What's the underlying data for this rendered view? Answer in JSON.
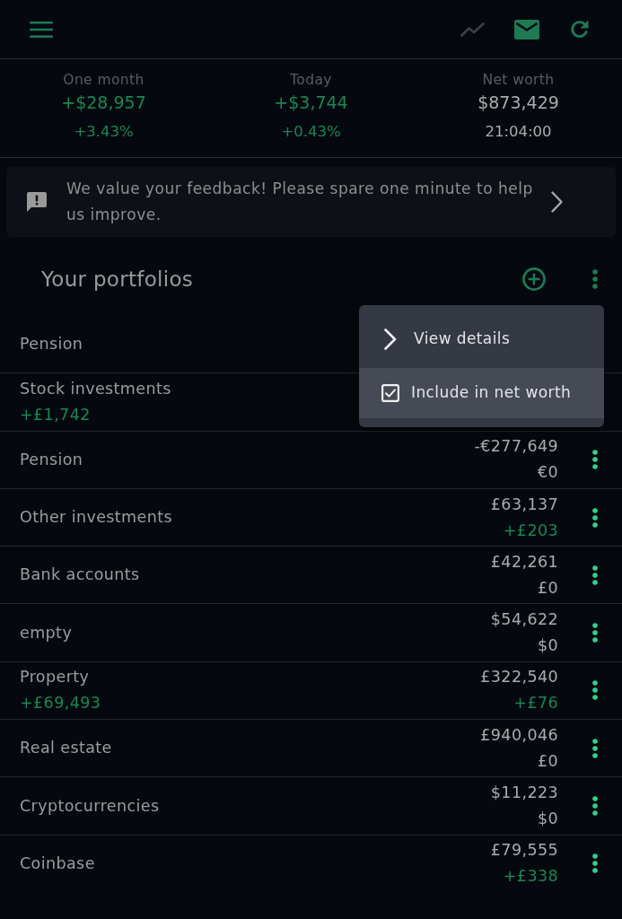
{
  "toolbar": {
    "actions": [
      {
        "kind": "trend",
        "disabled": true
      },
      {
        "kind": "mail",
        "disabled": false
      },
      {
        "kind": "refresh",
        "disabled": false
      }
    ]
  },
  "summary": [
    {
      "label": "One month",
      "value": "+$28,957",
      "detail": "+3.43%",
      "positive": true
    },
    {
      "label": "Today",
      "value": "+$3,744",
      "detail": "+0.43%",
      "positive": true
    },
    {
      "label": "Net worth",
      "value": "$873,429",
      "detail": "21:04:00",
      "positive": false
    }
  ],
  "feedback": {
    "text": "We value your feedback! Please spare one minute to help us improve."
  },
  "portfolios": {
    "title": "Your portfolios",
    "items": [
      {
        "name": "Pension"
      },
      {
        "name": "Stock investments",
        "gain": "+£1,742"
      },
      {
        "name": "Pension",
        "value": "-€277,649",
        "change": "€0",
        "change_positive": false
      },
      {
        "name": "Other investments",
        "value": "£63,137",
        "change": "+£203",
        "change_positive": true
      },
      {
        "name": "Bank accounts",
        "value": "£42,261",
        "change": "£0",
        "change_positive": false
      },
      {
        "name": "empty",
        "value": "$54,622",
        "change": "$0",
        "change_positive": false
      },
      {
        "name": "Property",
        "gain": "+£69,493",
        "value": "£322,540",
        "change": "+£76",
        "change_positive": true
      },
      {
        "name": "Real estate",
        "value": "£940,046",
        "change": "£0",
        "change_positive": false
      },
      {
        "name": "Cryptocurrencies",
        "value": "$11,223",
        "change": "$0",
        "change_positive": false
      },
      {
        "name": "Coinbase",
        "value": "£79,555",
        "change": "+£338",
        "change_positive": true
      }
    ]
  },
  "menu": {
    "items": [
      {
        "kind": "link",
        "label": "View details",
        "highlighted": false
      },
      {
        "kind": "checkbox",
        "label": "Include in net worth",
        "checked": true,
        "highlighted": true
      }
    ]
  }
}
